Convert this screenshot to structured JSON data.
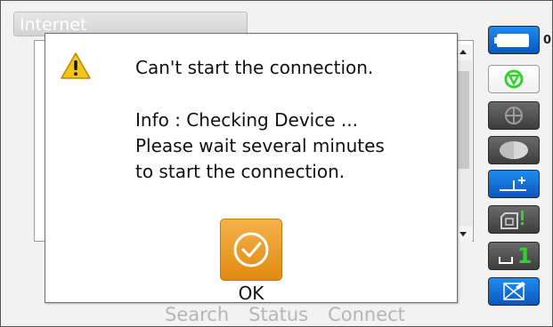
{
  "window": {
    "title": "Internet"
  },
  "softkeys": [
    "Search",
    "Status",
    "Connect"
  ],
  "sidebar": {
    "prism_count": "0",
    "target_value": "1"
  },
  "dialog": {
    "message": "Can't start the connection.",
    "info_lines": [
      "Info : Checking Device ...",
      "Please wait several minutes",
      "to start the connection."
    ],
    "ok_label": "OK"
  },
  "colors": {
    "accent": "#f0a030",
    "sidebar_active": "#1e6fd8",
    "sidebar_green": "#2fd22f"
  }
}
